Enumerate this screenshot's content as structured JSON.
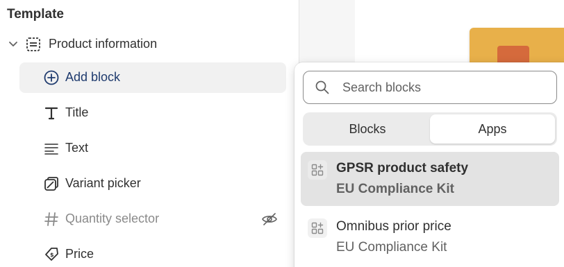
{
  "sidebar": {
    "section_title": "Template",
    "group": {
      "label": "Product information",
      "icon": "section-icon"
    },
    "add_block_label": "Add block",
    "blocks": [
      {
        "label": "Title",
        "icon": "title-icon",
        "hidden": false
      },
      {
        "label": "Text",
        "icon": "text-icon",
        "hidden": false
      },
      {
        "label": "Variant picker",
        "icon": "variant-picker-icon",
        "hidden": false
      },
      {
        "label": "Quantity selector",
        "icon": "hashtag-icon",
        "hidden": true
      },
      {
        "label": "Price",
        "icon": "price-tag-icon",
        "hidden": false
      }
    ]
  },
  "popover": {
    "search_placeholder": "Search blocks",
    "tabs": [
      {
        "label": "Blocks",
        "selected": false
      },
      {
        "label": "Apps",
        "selected": true
      }
    ],
    "app_blocks": [
      {
        "name": "GPSR product safety",
        "app": "EU Compliance Kit",
        "highlighted": true
      },
      {
        "name": "Omnibus prior price",
        "app": "EU Compliance Kit",
        "highlighted": false
      }
    ]
  },
  "colors": {
    "accent": "#1f3b6e",
    "muted_text": "#616161",
    "highlight_bg": "#e3e3e3",
    "product_box": "#e8b04a"
  }
}
